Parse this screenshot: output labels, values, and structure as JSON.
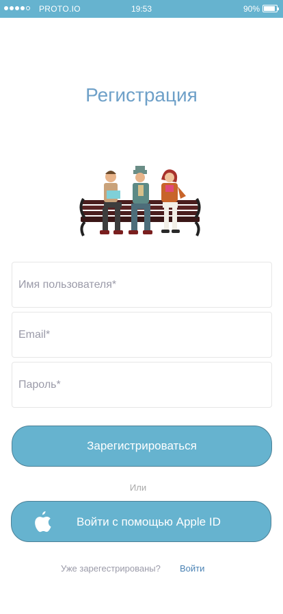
{
  "status_bar": {
    "carrier": "PROTO.IO",
    "time": "19:53",
    "battery": "90%",
    "battery_level": 0.9
  },
  "screen": {
    "title": "Регистрация"
  },
  "form": {
    "username_placeholder": "Имя пользователя*",
    "email_placeholder": "Email*",
    "password_placeholder": "Пароль*",
    "register_label": "Зарегистрироваться"
  },
  "divider": {
    "or_label": "Или"
  },
  "apple": {
    "label": "Войти с помощью Apple ID",
    "icon": "apple-icon"
  },
  "footer": {
    "question": "Уже зарегестрированы?",
    "login_link": "Войти"
  },
  "colors": {
    "accent": "#66b3cf",
    "title": "#6ea0c8",
    "link": "#4a82b4"
  }
}
